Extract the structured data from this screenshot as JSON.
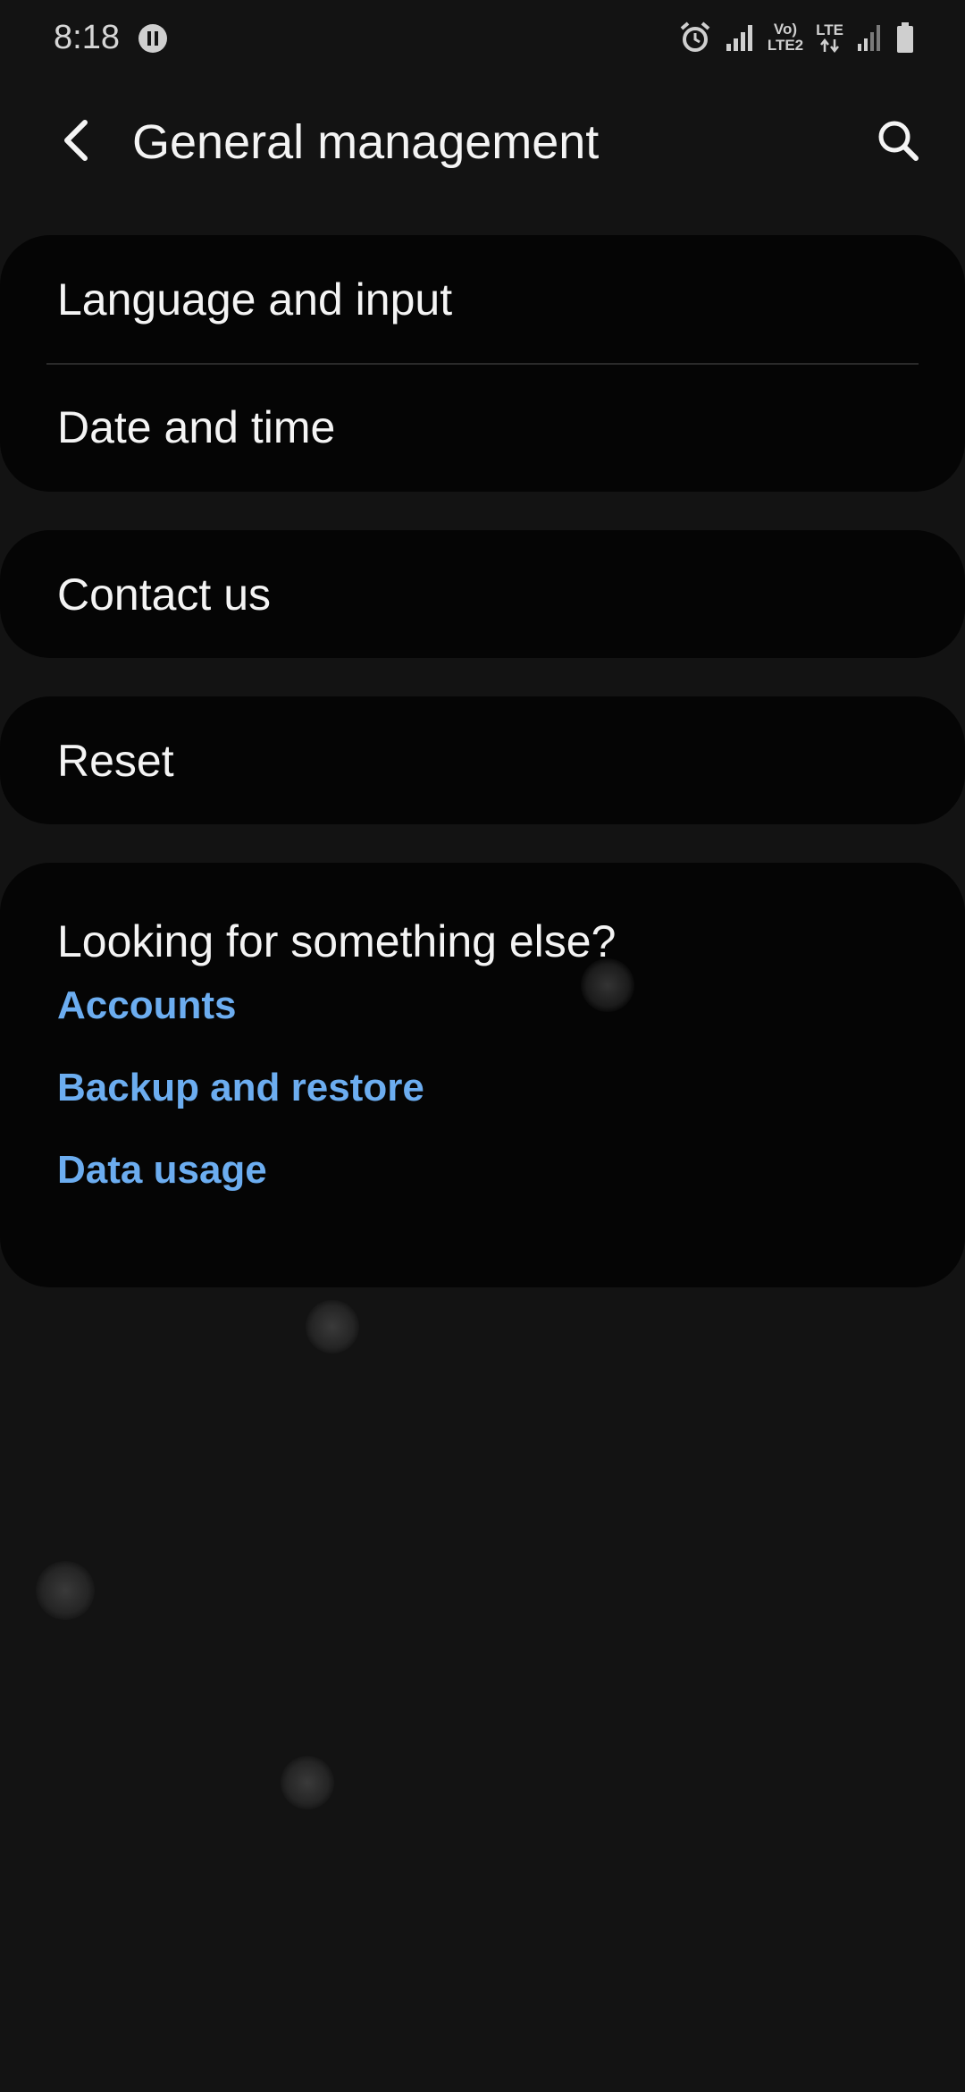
{
  "status_bar": {
    "time": "8:18",
    "volte_top": "Vo)",
    "volte_bottom": "LTE2",
    "lte": "LTE",
    "icons": [
      "pause-icon",
      "alarm-icon",
      "signal-icon",
      "volte-icon",
      "lte-data-icon",
      "signal-icon",
      "battery-icon"
    ]
  },
  "app_bar": {
    "title": "General management",
    "back_icon": "back-arrow-icon",
    "search_icon": "search-icon"
  },
  "settings": {
    "group1": [
      {
        "label": "Language and input"
      },
      {
        "label": "Date and time"
      }
    ],
    "contact_label": "Contact us",
    "reset_label": "Reset"
  },
  "suggestions": {
    "title": "Looking for something else?",
    "links": [
      {
        "label": "Accounts"
      },
      {
        "label": "Backup and restore"
      },
      {
        "label": "Data usage"
      }
    ]
  },
  "colors": {
    "background": "#131313",
    "card": "#050505",
    "link": "#6cadf0",
    "text": "#f4f4f4"
  }
}
